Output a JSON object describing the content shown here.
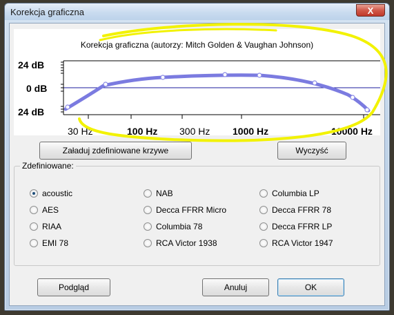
{
  "window": {
    "title": "Korekcja graficzna",
    "close_glyph": "X"
  },
  "graph": {
    "title": "Korekcja graficzna (autorzy: Mitch Golden & Vaughan Johnson)",
    "db_labels": [
      "24 dB",
      "0 dB",
      "24 dB"
    ],
    "freq_labels": [
      "30 Hz",
      "100 Hz",
      "300 Hz",
      "1000 Hz",
      "10000 Hz"
    ],
    "curve_color": "#7b7be0",
    "axis_color": "#1b1b9c"
  },
  "buttons": {
    "load": "Załaduj zdefiniowane krzywe",
    "clear": "Wyczyść",
    "preview": "Podgląd",
    "cancel": "Anuluj",
    "ok": "OK"
  },
  "presets": {
    "title": "Zdefiniowane:",
    "selected": "acoustic",
    "col1": [
      "acoustic",
      "AES",
      "RIAA",
      "EMI 78"
    ],
    "col2": [
      "NAB",
      "Decca FFRR Micro",
      "Columbia 78",
      "RCA Victor 1938"
    ],
    "col3": [
      "Columbia LP",
      "Decca FFRR 78",
      "Decca FFRR LP",
      "RCA Victor 1947"
    ]
  },
  "annotation": {
    "highlight_color": "#f2f200"
  }
}
